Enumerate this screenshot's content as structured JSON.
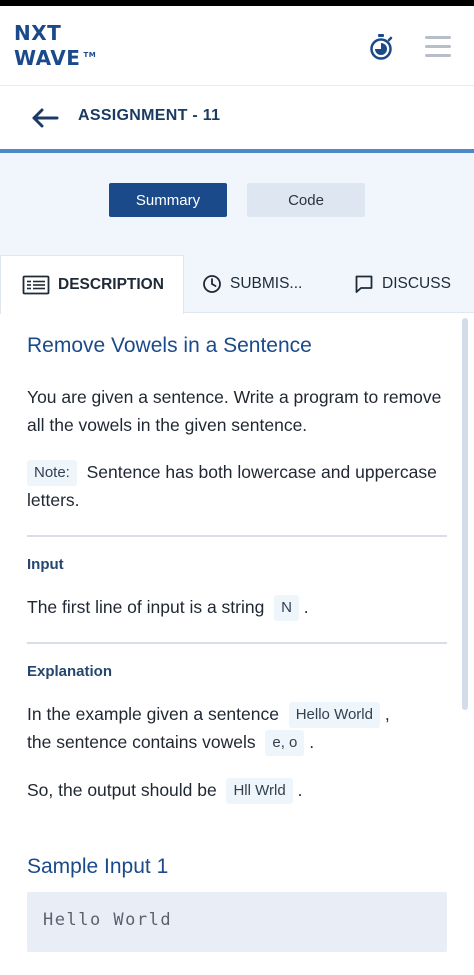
{
  "header": {
    "logo_line1": "NXT",
    "logo_line2": "WAVE",
    "logo_tm": "TM",
    "timer_icon": "stopwatch-icon",
    "menu_icon": "hamburger-menu-icon"
  },
  "assignment": {
    "back_icon": "arrow-left-icon",
    "title": "ASSIGNMENT - 11"
  },
  "switcher": {
    "summary_label": "Summary",
    "code_label": "Code"
  },
  "tabs": {
    "description": {
      "label": "DESCRIPTION",
      "icon": "description-icon"
    },
    "submissions": {
      "label": "SUBMIS...",
      "icon": "clock-icon"
    },
    "discuss": {
      "label": "DISCUSS",
      "icon": "chat-bubble-icon"
    }
  },
  "problem": {
    "title": "Remove Vowels in a Sentence",
    "intro": "You are given a sentence. Write a program to remove all the vowels in the given sentence.",
    "note_label": "Note:",
    "note_text": "Sentence has both lowercase and uppercase letters.",
    "input_heading": "Input",
    "input_text_pre": "The first line of input is a string",
    "input_chip": "N",
    "input_text_post": ".",
    "explanation_heading": "Explanation",
    "expl_pre": "In the example given a sentence",
    "expl_chip1": "Hello World",
    "expl_comma": ",",
    "expl_mid": "the sentence contains vowels",
    "expl_chip2": "e, o",
    "expl_end": ".",
    "output_pre": "So, the output should be",
    "output_chip": "Hll Wrld",
    "output_end": ".",
    "sample_title": "Sample Input 1",
    "sample_input": "Hello World"
  }
}
